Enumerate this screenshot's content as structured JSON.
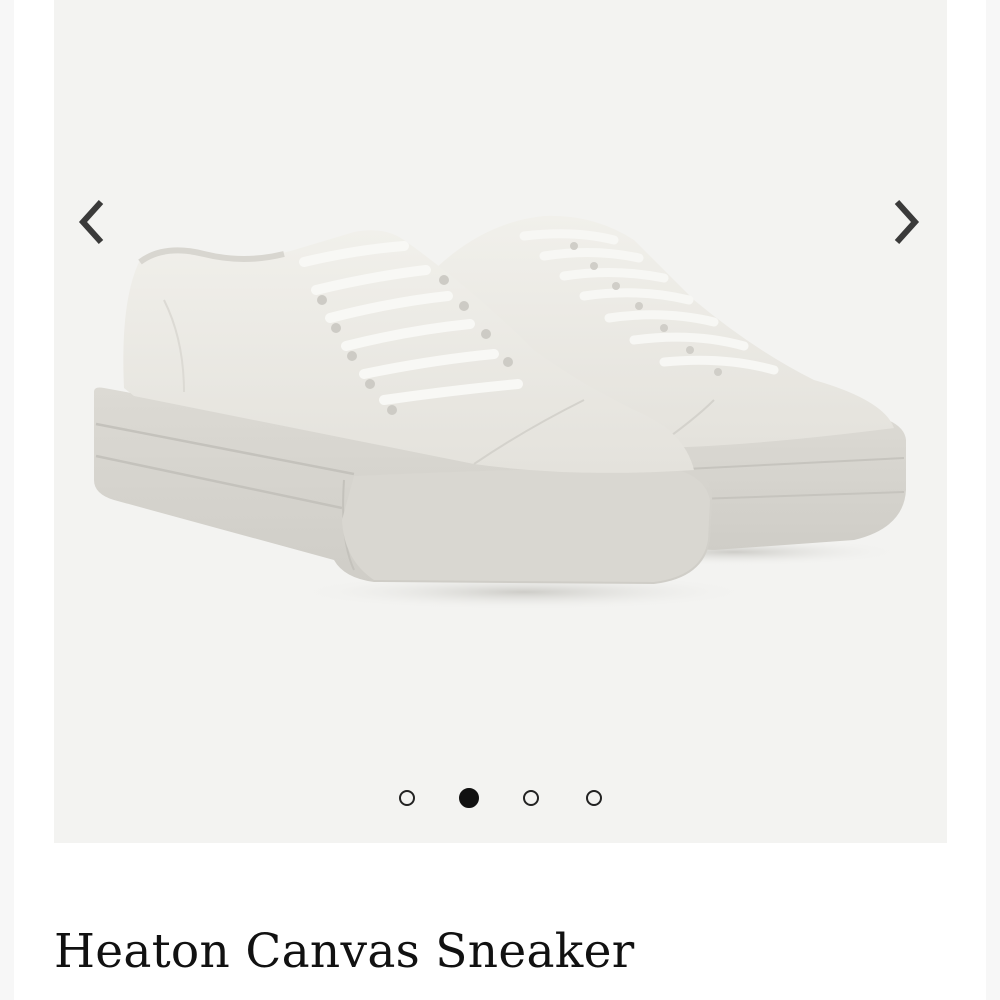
{
  "product": {
    "title": "Heaton Canvas Sneaker"
  },
  "carousel": {
    "prev_icon": "chevron-left-icon",
    "next_icon": "chevron-right-icon",
    "slide_count": 4,
    "active_slide": 2,
    "image_subject": "sneaker-pair"
  },
  "colors": {
    "image_background": "#f3f3f1",
    "arrow": "#3a3a3a",
    "dot": "#111111",
    "title": "#111111"
  }
}
